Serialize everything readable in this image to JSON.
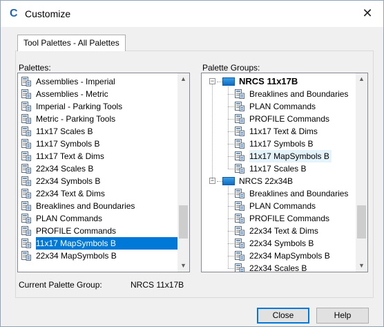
{
  "window": {
    "title": "Customize",
    "close_glyph": "✕"
  },
  "tab": {
    "label": "Tool Palettes - All Palettes"
  },
  "palettes": {
    "label": "Palettes:",
    "items": [
      {
        "label": "Assemblies - Imperial"
      },
      {
        "label": "Assemblies - Metric"
      },
      {
        "label": "Imperial - Parking Tools"
      },
      {
        "label": "Metric - Parking Tools"
      },
      {
        "label": "11x17 Scales B"
      },
      {
        "label": "11x17 Symbols B"
      },
      {
        "label": "11x17 Text & Dims"
      },
      {
        "label": "22x34 Scales B"
      },
      {
        "label": "22x34 Symbols B"
      },
      {
        "label": "22x34 Text & Dims"
      },
      {
        "label": "Breaklines and Boundaries"
      },
      {
        "label": "PLAN Commands"
      },
      {
        "label": "PROFILE Commands"
      },
      {
        "label": "11x17 MapSymbols B",
        "selected": true
      },
      {
        "label": "22x34 MapSymbols B"
      }
    ],
    "scroll_position": 0.85
  },
  "palette_groups": {
    "label": "Palette Groups:",
    "groups": [
      {
        "label": "NRCS 11x17B",
        "current": true,
        "expander": "−",
        "children": [
          {
            "label": "Breaklines and Boundaries"
          },
          {
            "label": "PLAN Commands"
          },
          {
            "label": "PROFILE Commands"
          },
          {
            "label": "11x17 Text & Dims"
          },
          {
            "label": "11x17 Symbols B"
          },
          {
            "label": "11x17 MapSymbols B",
            "hover": true
          },
          {
            "label": "11x17 Scales B"
          }
        ]
      },
      {
        "label": "NRCS 22x34B",
        "expander": "−",
        "children": [
          {
            "label": "Breaklines and Boundaries"
          },
          {
            "label": "PLAN Commands"
          },
          {
            "label": "PROFILE Commands"
          },
          {
            "label": "22x34 Text & Dims"
          },
          {
            "label": "22x34 Symbols B"
          },
          {
            "label": "22x34 MapSymbols B"
          },
          {
            "label": "22x34 Scales B"
          }
        ]
      }
    ],
    "scroll_position": 0.85
  },
  "footer": {
    "current_group_label": "Current Palette Group:",
    "current_group_value": "NRCS 11x17B"
  },
  "buttons": {
    "close": "Close",
    "help": "Help"
  },
  "colors": {
    "selection": "#0078d7",
    "hover": "#e5f3fb",
    "accent": "#1f63b8"
  },
  "icons": {
    "app": "autocad-c-icon",
    "palette": "palette-icon",
    "group": "palette-group-icon",
    "scroll_up": "chevron-up-icon",
    "scroll_down": "chevron-down-icon"
  }
}
